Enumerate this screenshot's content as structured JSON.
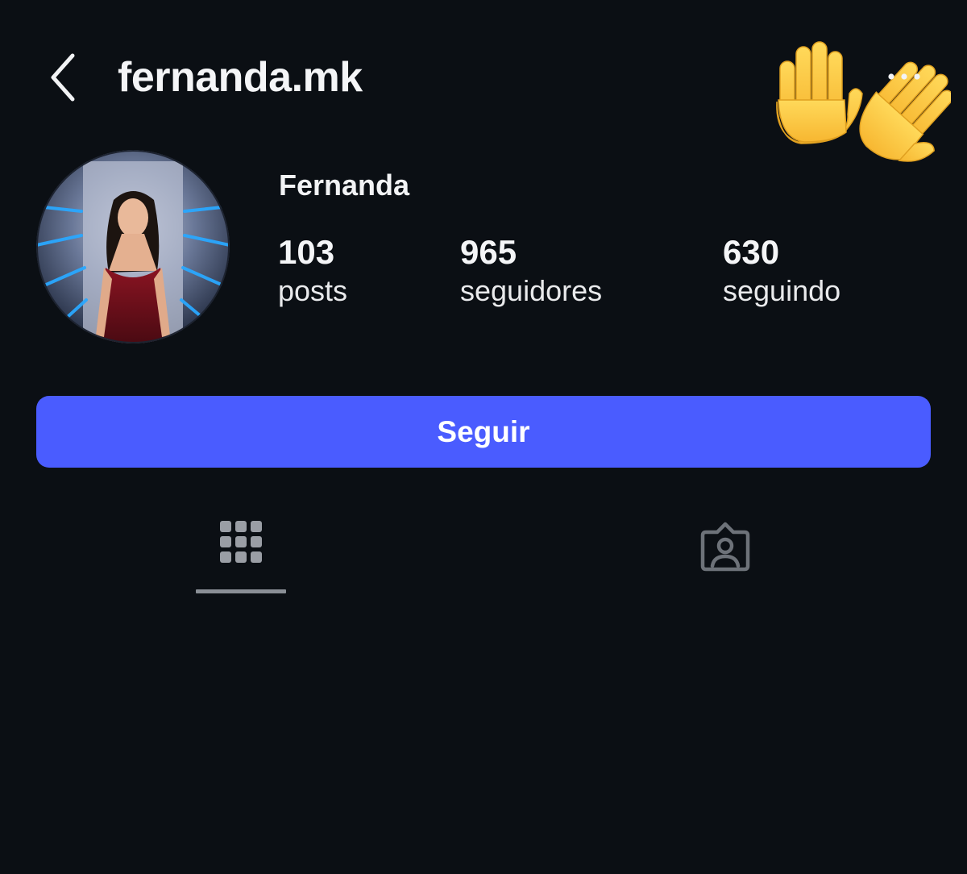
{
  "header": {
    "username": "fernanda.mk",
    "back_icon": "chevron-left-icon",
    "more_icon": "more-horizontal-icon",
    "sticker": "raised-hands-emoji"
  },
  "profile": {
    "display_name": "Fernanda",
    "stats": [
      {
        "value": "103",
        "label": "posts"
      },
      {
        "value": "965",
        "label": "seguidores"
      },
      {
        "value": "630",
        "label": "seguindo"
      }
    ]
  },
  "actions": {
    "follow_label": "Seguir",
    "follow_color": "#4a5cff"
  },
  "tabs": [
    {
      "name": "posts-grid",
      "icon": "grid-icon",
      "active": true
    },
    {
      "name": "tagged",
      "icon": "tagged-person-icon",
      "active": false
    }
  ],
  "colors": {
    "background": "#0b0f14",
    "text": "#f2f3f5",
    "tab_icon_active": "#9a9ea5",
    "tab_icon_inactive": "#6d7279"
  }
}
